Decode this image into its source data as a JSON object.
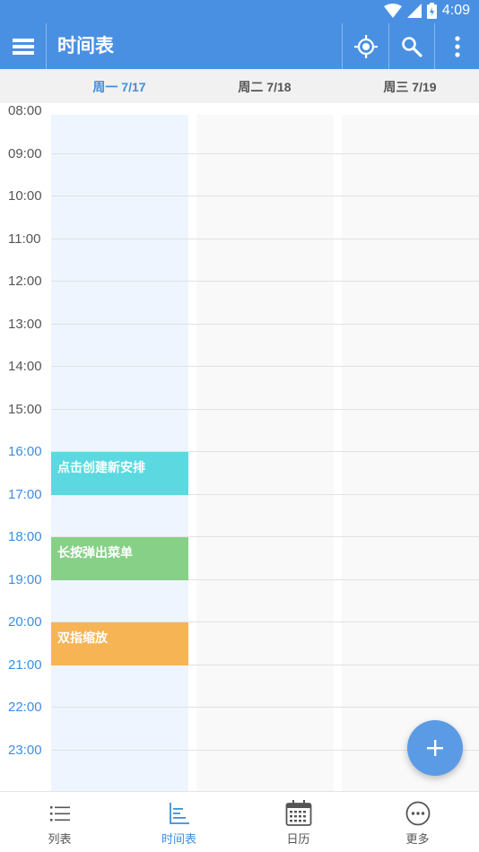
{
  "status_bar": {
    "time": "4:09"
  },
  "app_bar": {
    "title": "时间表",
    "actions": [
      "locate-icon",
      "search-icon",
      "more-vert-icon"
    ]
  },
  "days": [
    {
      "label": "周一 7/17",
      "active": true
    },
    {
      "label": "周二 7/18",
      "active": false
    },
    {
      "label": "周三 7/19",
      "active": false
    }
  ],
  "hours": [
    "08:00",
    "09:00",
    "10:00",
    "11:00",
    "12:00",
    "13:00",
    "14:00",
    "15:00",
    "16:00",
    "17:00",
    "18:00",
    "19:00",
    "20:00",
    "21:00",
    "22:00",
    "23:00"
  ],
  "highlighted_hours": [
    "16:00",
    "17:00",
    "18:00",
    "19:00",
    "20:00",
    "21:00",
    "22:00",
    "23:00"
  ],
  "events": [
    {
      "title": "点击创建新安排",
      "start": "16:00",
      "end": "17:00",
      "color": "#5cd9e0"
    },
    {
      "title": "长按弹出菜单",
      "start": "18:00",
      "end": "19:00",
      "color": "#87d087"
    },
    {
      "title": "双指缩放",
      "start": "20:00",
      "end": "21:00",
      "color": "#f7b455"
    }
  ],
  "colors": {
    "primary": "#4a90e2",
    "accent": "#3d8ee0",
    "fab": "#5b9be6"
  },
  "bottom_nav": [
    {
      "label": "列表",
      "icon": "list-icon",
      "active": false
    },
    {
      "label": "时间表",
      "icon": "timetable-icon",
      "active": true
    },
    {
      "label": "日历",
      "icon": "calendar-icon",
      "active": false
    },
    {
      "label": "更多",
      "icon": "more-circle-icon",
      "active": false
    }
  ]
}
